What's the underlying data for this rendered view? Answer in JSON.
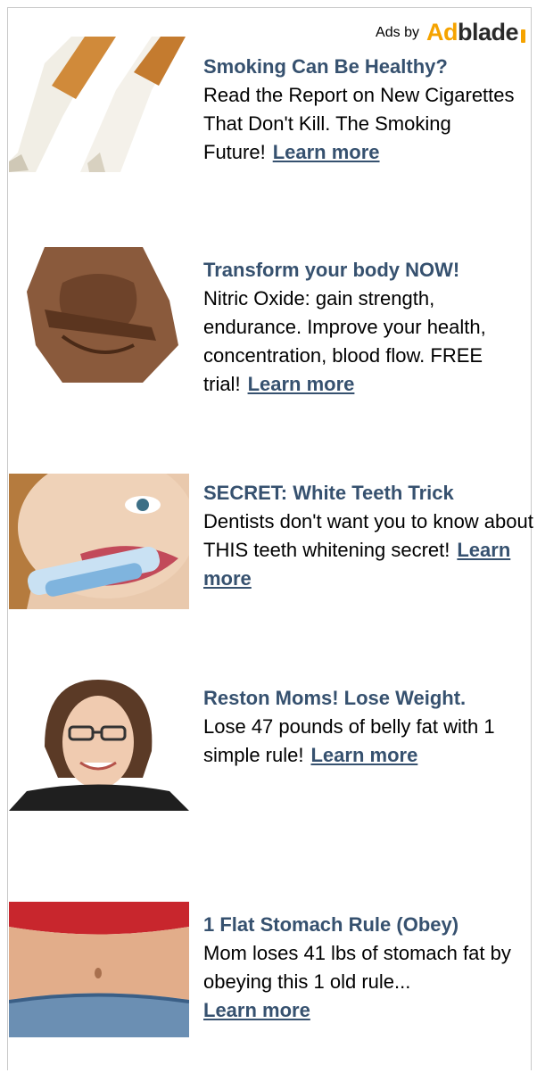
{
  "header": {
    "ads_by": "Ads by",
    "logo_ad": "Ad",
    "logo_blade": "blade"
  },
  "ads": [
    {
      "headline": "Smoking Can Be Healthy?",
      "body": "Read the Report on New Cigarettes That Don't Kill. The Smoking Future!",
      "cta": "Learn more",
      "image": "cigarettes"
    },
    {
      "headline": "Transform your body NOW!",
      "body": "Nitric Oxide: gain strength, endurance. Improve your health, concentration, blood flow. FREE trial!",
      "cta": "Learn more",
      "image": "muscular-torso"
    },
    {
      "headline": "SECRET: White Teeth Trick",
      "body": "Dentists don't want you to know about THIS teeth whitening secret!",
      "cta": "Learn more",
      "image": "woman-teeth-whitening"
    },
    {
      "headline": "Reston Moms! Lose Weight.",
      "body": "Lose 47 pounds of belly fat with 1 simple rule!",
      "cta": "Learn more",
      "image": "woman-portrait"
    },
    {
      "headline": "1 Flat Stomach Rule (Obey)",
      "body": "Mom loses 41 lbs of stomach fat by obeying this 1 old rule...",
      "cta": "Learn more",
      "image": "flat-stomach"
    }
  ],
  "colors": {
    "link": "#36516f",
    "logo_orange": "#f5a300",
    "border": "#c9c9c9"
  }
}
